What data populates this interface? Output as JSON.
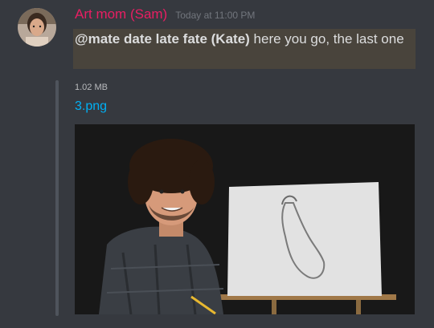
{
  "message": {
    "username": "Art mom (Sam)",
    "username_color": "#e91e63",
    "timestamp": "Today at 11:00 PM",
    "mention": "@mate date late fate (Kate)",
    "text": " here you go, the last one",
    "highlight_color": "#49443c"
  },
  "attachment": {
    "size": "1.02 MB",
    "filename": "3.png",
    "link_color": "#00b0f4"
  }
}
